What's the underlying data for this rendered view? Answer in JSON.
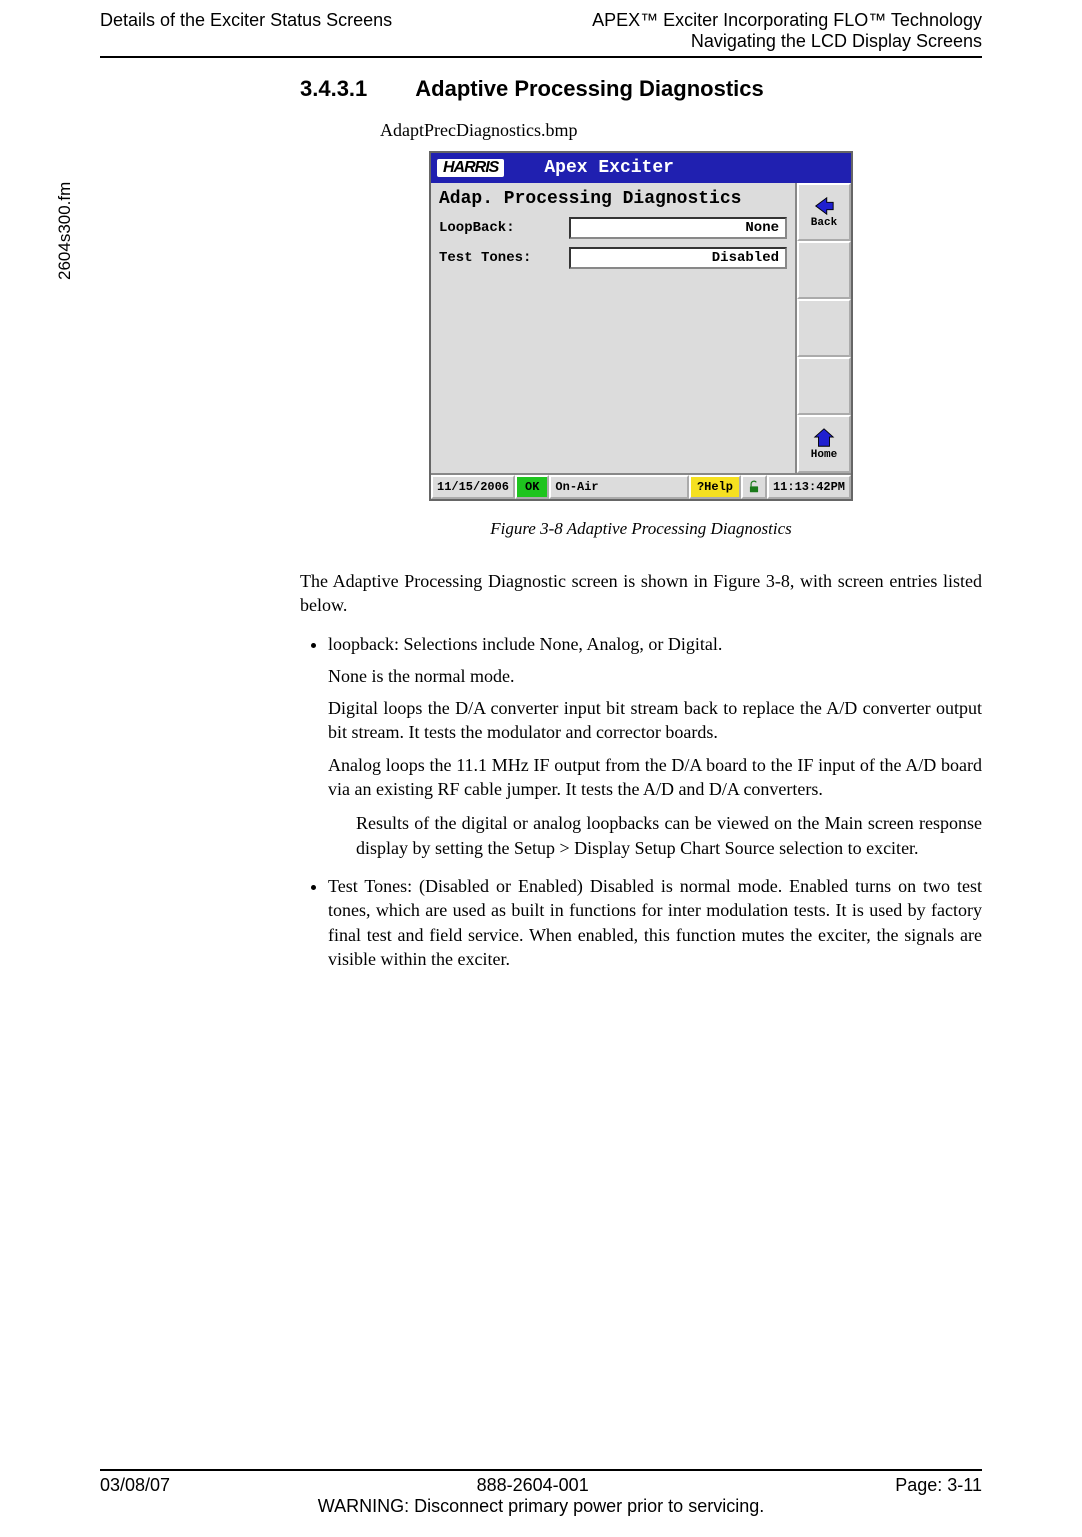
{
  "header": {
    "left": "Details of the Exciter Status Screens",
    "right1": "APEX™ Exciter Incorporating FLO™ Technology",
    "right2": "Navigating the LCD Display Screens"
  },
  "side_filename": "2604s300.fm",
  "section": {
    "number": "3.4.3.1",
    "title": "Adaptive Processing Diagnostics"
  },
  "bmp_name": "AdaptPrecDiagnostics.bmp",
  "lcd": {
    "logo": "HARRIS",
    "window_title": "Apex Exciter",
    "main_title": "Adap. Processing Diagnostics",
    "rows": [
      {
        "label": "LoopBack:",
        "value": "None"
      },
      {
        "label": "Test Tones:",
        "value": "Disabled"
      }
    ],
    "side_buttons": {
      "back": "Back",
      "home": "Home"
    },
    "status": {
      "date": "11/15/2006",
      "ok": "OK",
      "onair": "On-Air",
      "help": "?Help",
      "time": "11:13:42PM"
    }
  },
  "figure_caption": "Figure 3-8  Adaptive Processing Diagnostics",
  "body": {
    "intro": "The Adaptive Processing Diagnostic screen is shown in Figure 3-8, with screen entries listed below.",
    "bullets": [
      {
        "lead": "loopback: Selections include None, Analog, or Digital.",
        "p1": "None is the normal mode.",
        "p2": "Digital loops the D/A converter input bit stream back to replace the A/D converter output bit stream. It tests the modulator and corrector boards.",
        "p3": "Analog loops the 11.1 MHz IF output from the D/A board to the IF input of the A/D board via an existing RF cable jumper. It tests the A/D and D/A converters.",
        "inset": "Results of the digital or analog loopbacks can be viewed on the Main screen response display by setting the Setup > Display Setup Chart Source selection to exciter."
      },
      {
        "lead": "Test Tones: (Disabled or Enabled) Disabled is normal mode. Enabled turns on two test tones, which are used as built in functions for inter modulation tests. It is used by factory final test and field service. When enabled, this function mutes the exciter, the signals are visible within the exciter."
      }
    ]
  },
  "footer": {
    "date": "03/08/07",
    "docnum": "888-2604-001",
    "page": "Page: 3-11",
    "warning": "WARNING: Disconnect primary power prior to servicing."
  }
}
